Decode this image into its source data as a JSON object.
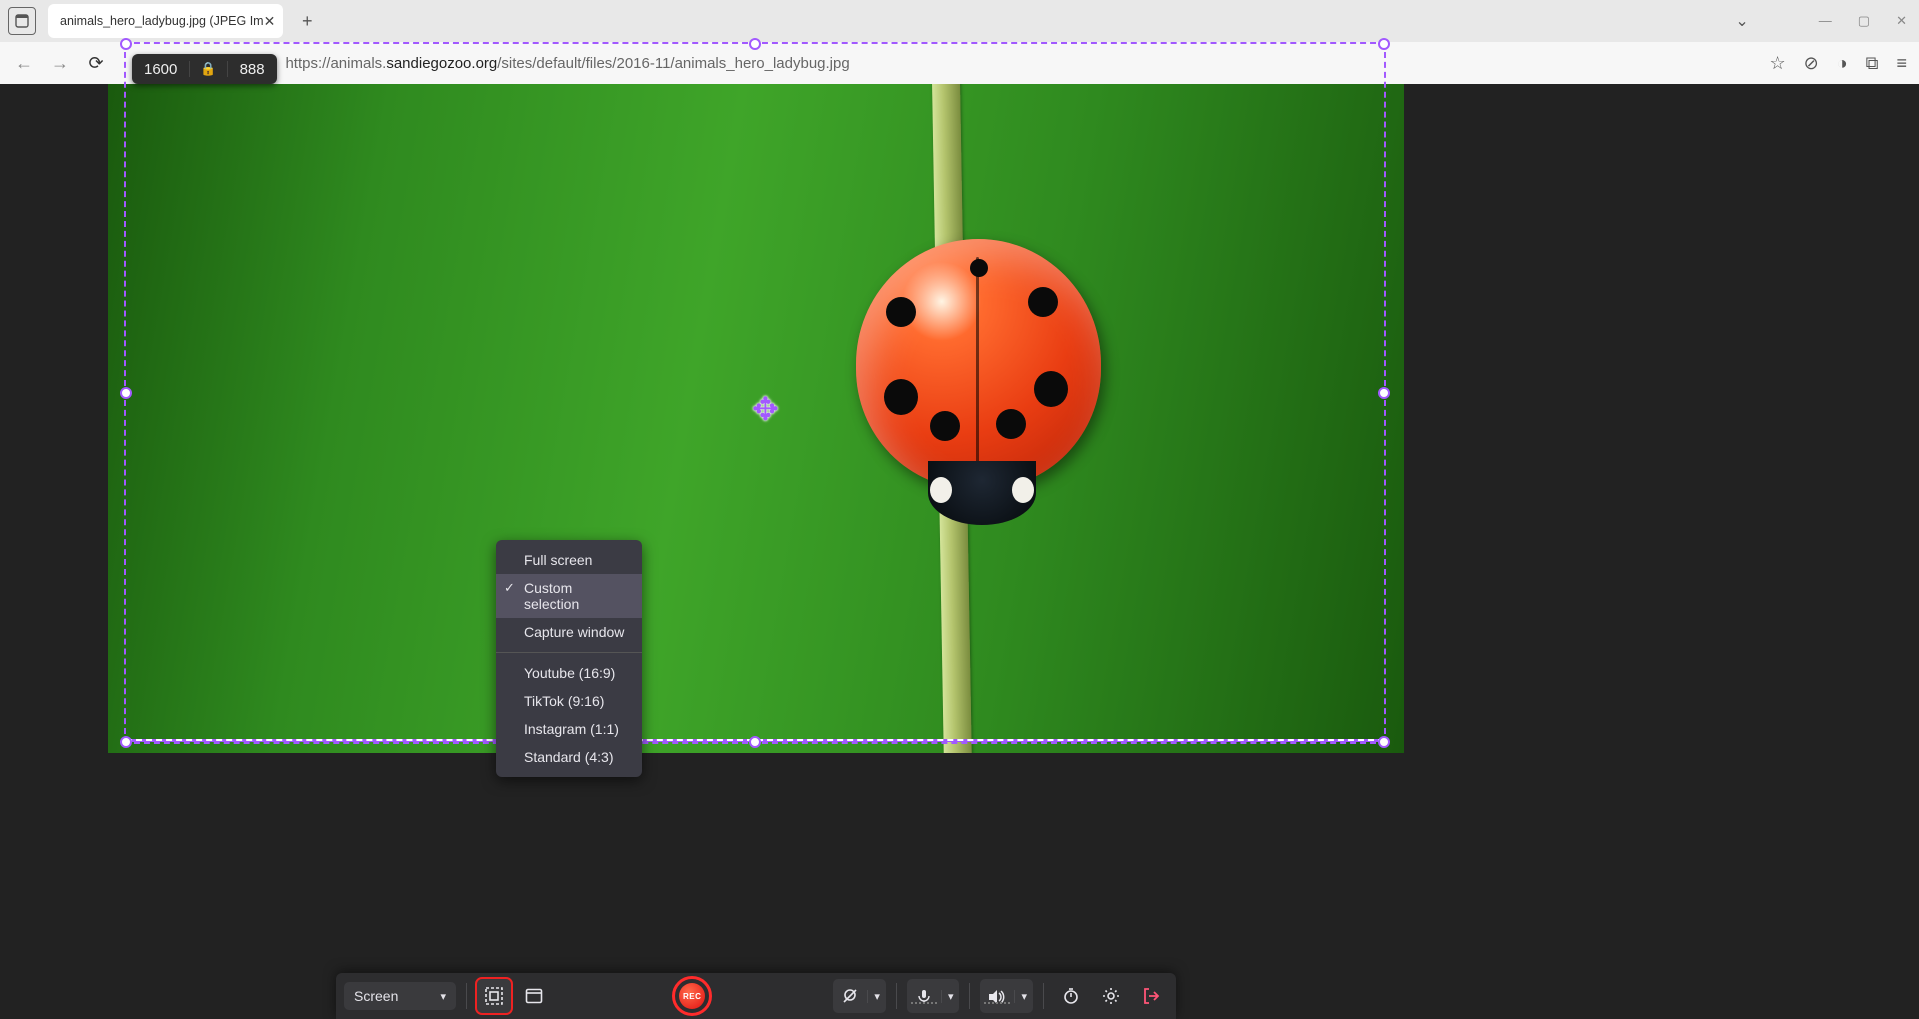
{
  "browser": {
    "tab_title": "animals_hero_ladybug.jpg (JPEG Im",
    "url_prefix": "https://animals.",
    "url_domain": "sandiegozoo.org",
    "url_suffix": "/sites/default/files/2016-11/animals_hero_ladybug.jpg"
  },
  "selection": {
    "width": "1600",
    "height": "888"
  },
  "popup": {
    "items": [
      {
        "label": "Full screen",
        "selected": false
      },
      {
        "label": "Custom selection",
        "selected": true
      },
      {
        "label": "Capture window",
        "selected": false
      }
    ],
    "presets": [
      {
        "label": "Youtube (16:9)"
      },
      {
        "label": "TikTok (9:16)"
      },
      {
        "label": "Instagram (1:1)"
      },
      {
        "label": "Standard (4:3)"
      }
    ]
  },
  "toolbar": {
    "source_label": "Screen",
    "record_label": "REC"
  }
}
